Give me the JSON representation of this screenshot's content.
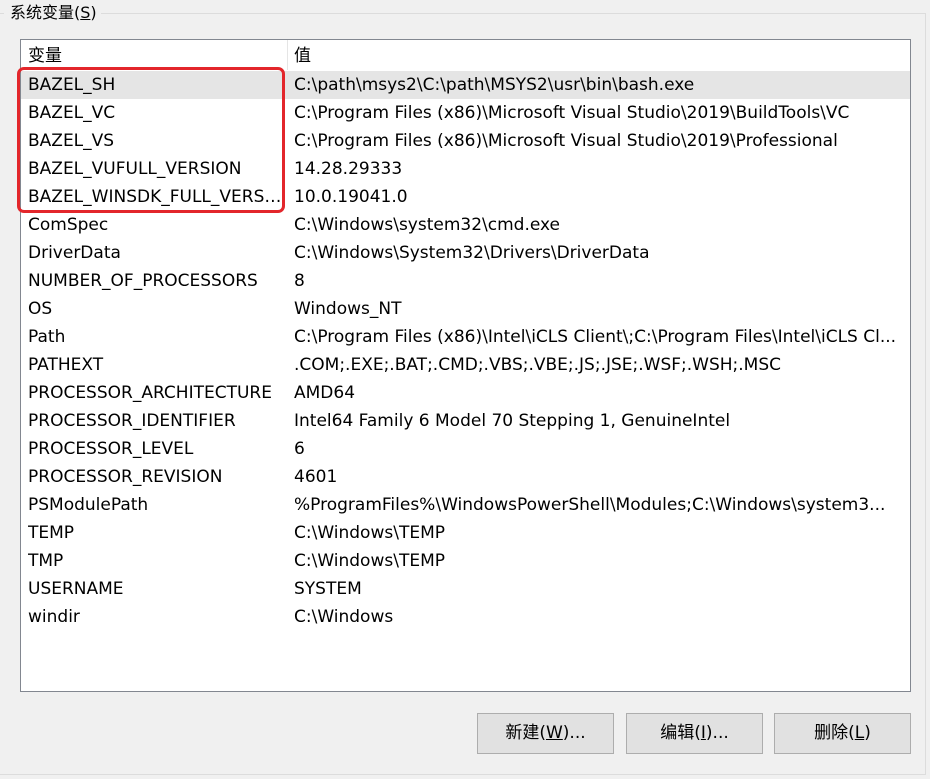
{
  "group": {
    "title_prefix": "系统变量(",
    "title_mnemonic": "S",
    "title_suffix": ")"
  },
  "list": {
    "columns": [
      "变量",
      "值"
    ],
    "rows": [
      {
        "name": "BAZEL_SH",
        "value": "C:\\path\\msys2\\C:\\path\\MSYS2\\usr\\bin\\bash.exe",
        "selected": true
      },
      {
        "name": "BAZEL_VC",
        "value": "C:\\Program Files (x86)\\Microsoft Visual Studio\\2019\\BuildTools\\VC"
      },
      {
        "name": "BAZEL_VS",
        "value": "C:\\Program Files (x86)\\Microsoft Visual Studio\\2019\\Professional"
      },
      {
        "name": "BAZEL_VUFULL_VERSION",
        "value": "14.28.29333"
      },
      {
        "name": "BAZEL_WINSDK_FULL_VERSI...",
        "value": "10.0.19041.0"
      },
      {
        "name": "ComSpec",
        "value": "C:\\Windows\\system32\\cmd.exe"
      },
      {
        "name": "DriverData",
        "value": "C:\\Windows\\System32\\Drivers\\DriverData"
      },
      {
        "name": "NUMBER_OF_PROCESSORS",
        "value": "8"
      },
      {
        "name": "OS",
        "value": "Windows_NT"
      },
      {
        "name": "Path",
        "value": "C:\\Program Files (x86)\\Intel\\iCLS Client\\;C:\\Program Files\\Intel\\iCLS Cl..."
      },
      {
        "name": "PATHEXT",
        "value": ".COM;.EXE;.BAT;.CMD;.VBS;.VBE;.JS;.JSE;.WSF;.WSH;.MSC"
      },
      {
        "name": "PROCESSOR_ARCHITECTURE",
        "value": "AMD64"
      },
      {
        "name": "PROCESSOR_IDENTIFIER",
        "value": "Intel64 Family 6 Model 70 Stepping 1, GenuineIntel"
      },
      {
        "name": "PROCESSOR_LEVEL",
        "value": "6"
      },
      {
        "name": "PROCESSOR_REVISION",
        "value": "4601"
      },
      {
        "name": "PSModulePath",
        "value": "%ProgramFiles%\\WindowsPowerShell\\Modules;C:\\Windows\\system3..."
      },
      {
        "name": "TEMP",
        "value": "C:\\Windows\\TEMP"
      },
      {
        "name": "TMP",
        "value": "C:\\Windows\\TEMP"
      },
      {
        "name": "USERNAME",
        "value": "SYSTEM"
      },
      {
        "name": "windir",
        "value": "C:\\Windows"
      }
    ]
  },
  "buttons": {
    "new": {
      "prefix": "新建(",
      "mnemonic": "W",
      "suffix": ")..."
    },
    "edit": {
      "prefix": "编辑(",
      "mnemonic": "I",
      "suffix": ")..."
    },
    "delete": {
      "prefix": "删除(",
      "mnemonic": "L",
      "suffix": ")"
    }
  },
  "colors": {
    "highlight_border": "#e3262b",
    "selected_row": "#e5e5e5"
  }
}
